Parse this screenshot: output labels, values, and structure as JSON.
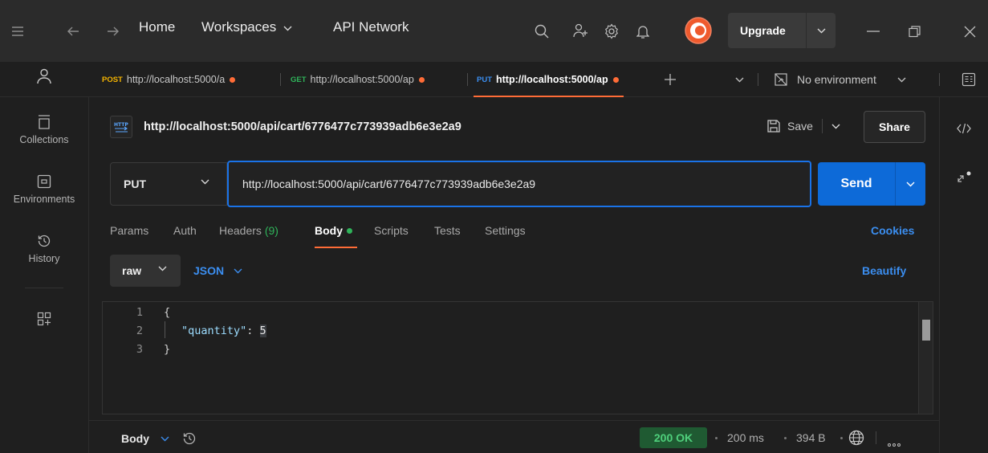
{
  "titlebar": {
    "nav": [
      "Home",
      "Workspaces",
      "API Network"
    ],
    "upgrade_label": "Upgrade"
  },
  "tabs": [
    {
      "method": "POST",
      "method_color": "#f5b400",
      "url": "http://localhost:5000/a"
    },
    {
      "method": "GET",
      "method_color": "#2fb35a",
      "url": "http://localhost:5000/ap"
    },
    {
      "method": "PUT",
      "method_color": "#3b8ef0",
      "url": "http://localhost:5000/ap",
      "active": true
    }
  ],
  "environment": {
    "label": "No environment"
  },
  "sidebar": {
    "items": [
      {
        "label": "Collections"
      },
      {
        "label": "Environments"
      },
      {
        "label": "History"
      }
    ]
  },
  "request": {
    "title": "http://localhost:5000/api/cart/6776477c773939adb6e3e2a9",
    "method": "PUT",
    "url": "http://localhost:5000/api/cart/6776477c773939adb6e3e2a9",
    "save_label": "Save",
    "share_label": "Share",
    "send_label": "Send"
  },
  "request_tabs": {
    "params": "Params",
    "auth": "Auth",
    "headers": "Headers",
    "headers_count": "(9)",
    "body": "Body",
    "scripts": "Scripts",
    "tests": "Tests",
    "settings": "Settings",
    "cookies": "Cookies"
  },
  "body_mode": {
    "type": "raw",
    "format": "JSON",
    "beautify": "Beautify"
  },
  "editor": {
    "line_numbers": [
      "1",
      "2",
      "3"
    ],
    "open_brace": "{",
    "key": "\"quantity\"",
    "colon": ": ",
    "value": "5",
    "close_brace": "}"
  },
  "response": {
    "body_label": "Body",
    "status": "200 OK",
    "time": "200 ms",
    "size": "394 B"
  },
  "colors": {
    "accent": "#ff6c37",
    "send": "#0d6ad8",
    "link": "#3b8ef0",
    "success": "#4fd07c"
  }
}
